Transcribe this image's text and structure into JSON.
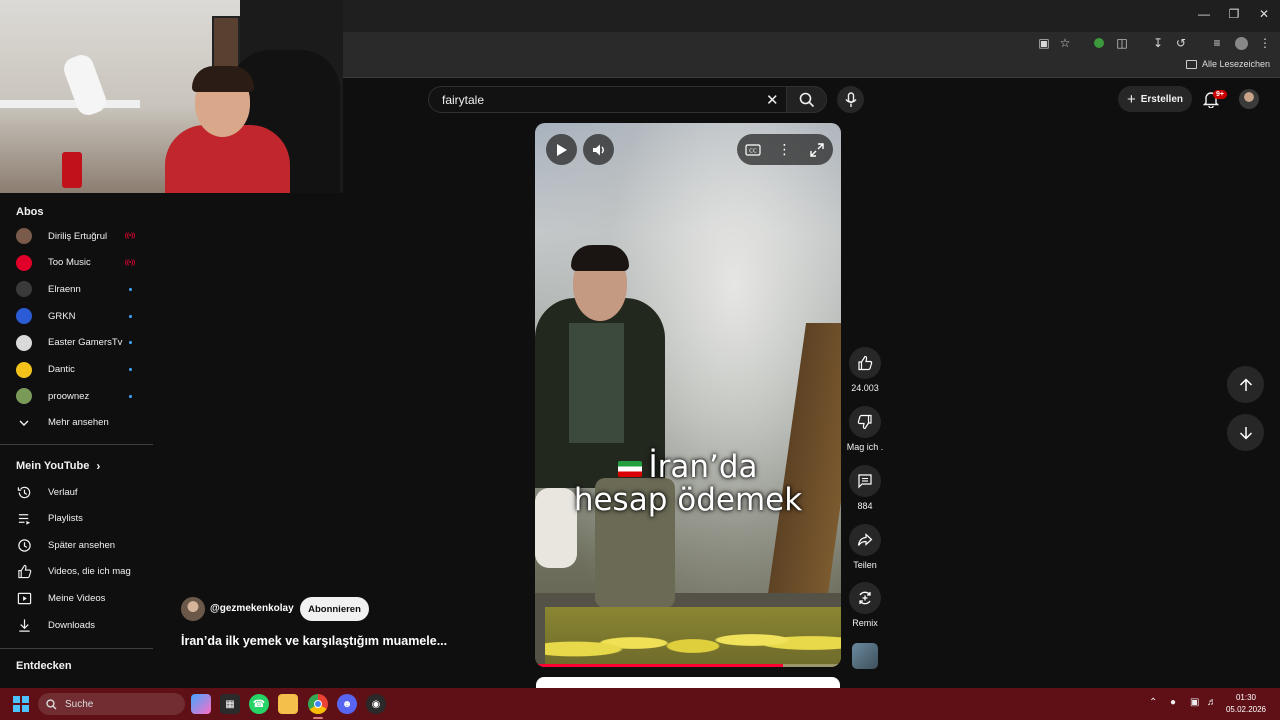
{
  "browser": {
    "bookmarks_label": "Alle Lesezeichen"
  },
  "header": {
    "search_value": "fairytale",
    "create_label": "Erstellen",
    "notifications_badge": "9+"
  },
  "sidebar": {
    "subscriptions_heading": "Abos",
    "channels": [
      {
        "name": "Diriliş Ertuğrul",
        "status": "live",
        "avatar_color": "#7a5a4a"
      },
      {
        "name": "Too Music",
        "status": "live",
        "avatar_color": "#e0002a"
      },
      {
        "name": "Elraenn",
        "status": "new",
        "avatar_color": "#3a3a3a"
      },
      {
        "name": "GRKN",
        "status": "new",
        "avatar_color": "#2b5cd6"
      },
      {
        "name": "Easter GamersTv",
        "status": "new",
        "avatar_color": "#d9d9d9"
      },
      {
        "name": "Dantic",
        "status": "new",
        "avatar_color": "#f2c21b"
      },
      {
        "name": "proownez",
        "status": "new",
        "avatar_color": "#7a9a5a"
      }
    ],
    "show_more_label": "Mehr ansehen",
    "my_youtube_heading": "Mein YouTube",
    "my_youtube_items": [
      {
        "label": "Verlauf",
        "icon": "history-icon"
      },
      {
        "label": "Playlists",
        "icon": "playlists-icon"
      },
      {
        "label": "Später ansehen",
        "icon": "watch-later-icon"
      },
      {
        "label": "Videos, die ich mag",
        "icon": "like-icon"
      },
      {
        "label": "Meine Videos",
        "icon": "my-videos-icon"
      },
      {
        "label": "Downloads",
        "icon": "download-icon"
      }
    ],
    "explore_heading": "Entdecken"
  },
  "short": {
    "caption_line1": "İran’da",
    "caption_line2": "hesap ödemek",
    "progress": 0.81,
    "channel_handle": "@gezmekenkolay",
    "subscribe_label": "Abonnieren",
    "title": "İran’da ilk yemek ve karşılaştığım muamele..."
  },
  "actions": {
    "likes": "24.003",
    "dislike_label": "Mag ich .",
    "comments": "884",
    "share_label": "Teilen",
    "remix_label": "Remix"
  },
  "taskbar": {
    "search_label": "Suche",
    "time": "01:30",
    "date": "05.02.2026"
  },
  "colors": {
    "background": "#0f0f0f",
    "accent_red": "#ff0033",
    "taskbar": "#5e1016",
    "new_dot": "#3ea6ff"
  }
}
